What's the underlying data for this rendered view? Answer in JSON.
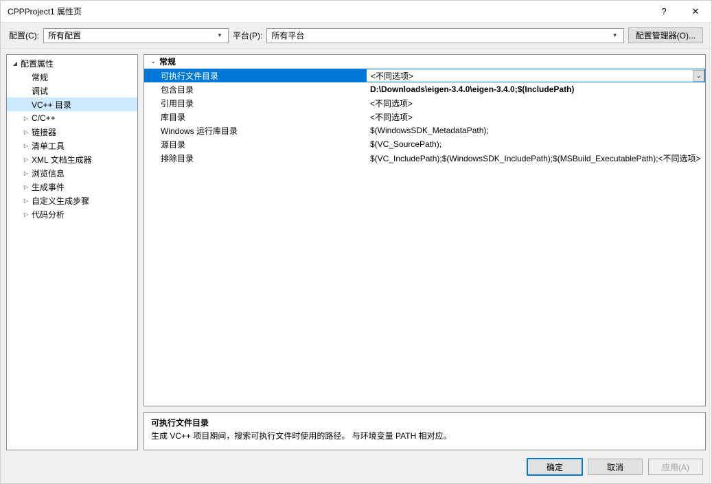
{
  "window": {
    "title": "CPPProject1 属性页",
    "help": "?",
    "close": "✕"
  },
  "toolbar": {
    "config_label": "配置(C):",
    "config_value": "所有配置",
    "platform_label": "平台(P):",
    "platform_value": "所有平台",
    "manager_label": "配置管理器(O)..."
  },
  "tree": {
    "root": "配置属性",
    "items": [
      {
        "label": "常规",
        "expandable": false
      },
      {
        "label": "调试",
        "expandable": false
      },
      {
        "label": "VC++ 目录",
        "expandable": false,
        "selected": true
      },
      {
        "label": "C/C++",
        "expandable": true
      },
      {
        "label": "链接器",
        "expandable": true
      },
      {
        "label": "清单工具",
        "expandable": true
      },
      {
        "label": "XML 文档生成器",
        "expandable": true
      },
      {
        "label": "浏览信息",
        "expandable": true
      },
      {
        "label": "生成事件",
        "expandable": true
      },
      {
        "label": "自定义生成步骤",
        "expandable": true
      },
      {
        "label": "代码分析",
        "expandable": true
      }
    ]
  },
  "grid": {
    "category": "常规",
    "rows": [
      {
        "name": "可执行文件目录",
        "value": "<不同选项>",
        "selected": true
      },
      {
        "name": "包含目录",
        "value": "D:\\Downloads\\eigen-3.4.0\\eigen-3.4.0;$(IncludePath)",
        "bold": true
      },
      {
        "name": "引用目录",
        "value": "<不同选项>"
      },
      {
        "name": "库目录",
        "value": "<不同选项>"
      },
      {
        "name": "Windows 运行库目录",
        "value": "$(WindowsSDK_MetadataPath);"
      },
      {
        "name": "源目录",
        "value": "$(VC_SourcePath);"
      },
      {
        "name": "排除目录",
        "value": "$(VC_IncludePath);$(WindowsSDK_IncludePath);$(MSBuild_ExecutablePath);<不同选项>"
      }
    ]
  },
  "desc": {
    "title": "可执行文件目录",
    "text": "生成 VC++ 项目期间，搜索可执行文件时使用的路径。 与环境变量 PATH 相对应。"
  },
  "footer": {
    "ok": "确定",
    "cancel": "取消",
    "apply": "应用(A)"
  }
}
